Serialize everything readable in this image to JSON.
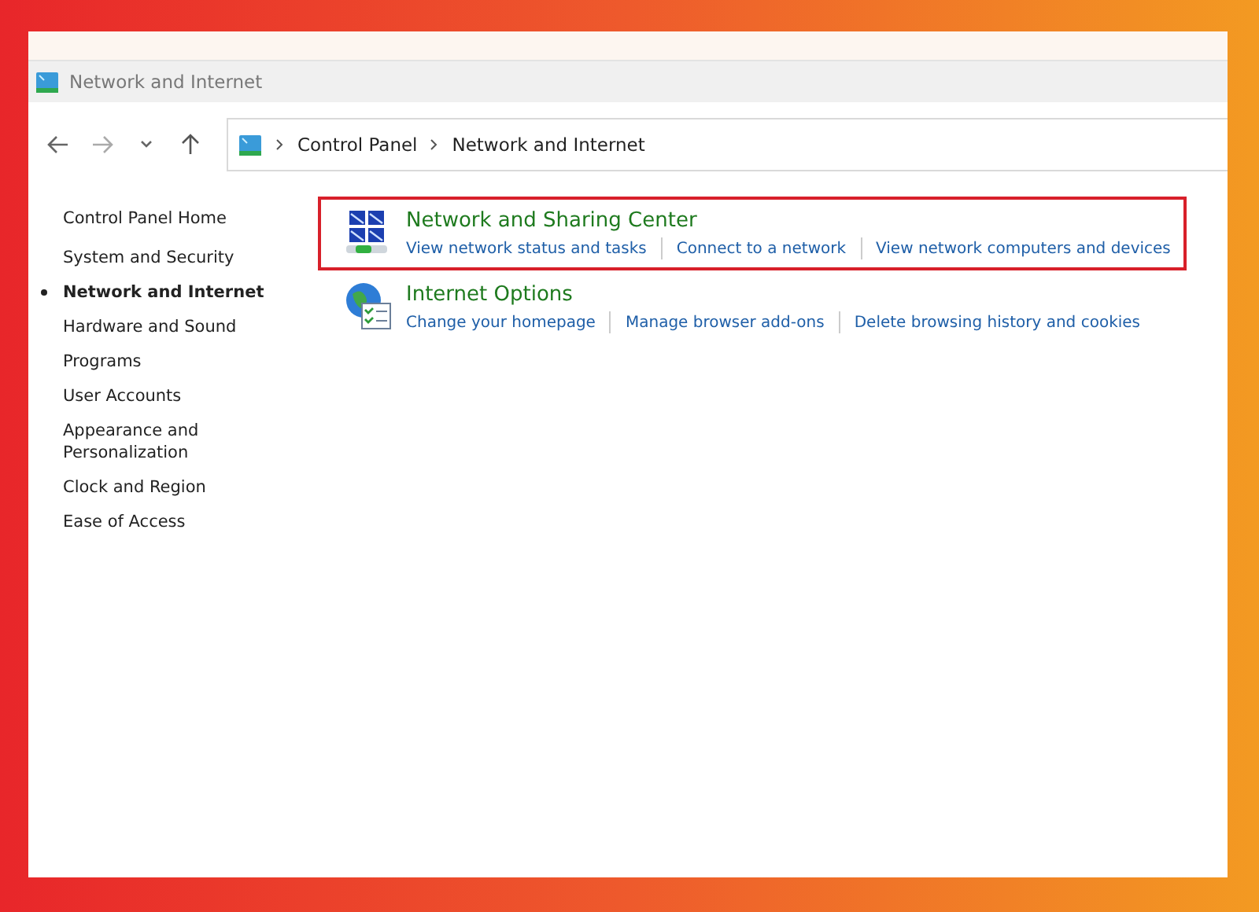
{
  "window": {
    "title": "Network and Internet"
  },
  "address_bar": {
    "breadcrumbs": [
      {
        "label": "Control Panel"
      },
      {
        "label": "Network and Internet"
      }
    ]
  },
  "sidebar": {
    "home": "Control Panel Home",
    "items": [
      {
        "label": "System and Security",
        "selected": false
      },
      {
        "label": "Network and Internet",
        "selected": true
      },
      {
        "label": "Hardware and Sound",
        "selected": false
      },
      {
        "label": "Programs",
        "selected": false
      },
      {
        "label": "User Accounts",
        "selected": false
      },
      {
        "label": "Appearance and Personalization",
        "selected": false
      },
      {
        "label": "Clock and Region",
        "selected": false
      },
      {
        "label": "Ease of Access",
        "selected": false
      }
    ]
  },
  "categories": [
    {
      "kind": "network",
      "title": "Network and Sharing Center",
      "highlighted": true,
      "links": [
        "View network status and tasks",
        "Connect to a network",
        "View network computers and devices"
      ]
    },
    {
      "kind": "internet",
      "title": "Internet Options",
      "highlighted": false,
      "links": [
        "Change your homepage",
        "Manage browser add-ons",
        "Delete browsing history and cookies"
      ]
    }
  ]
}
